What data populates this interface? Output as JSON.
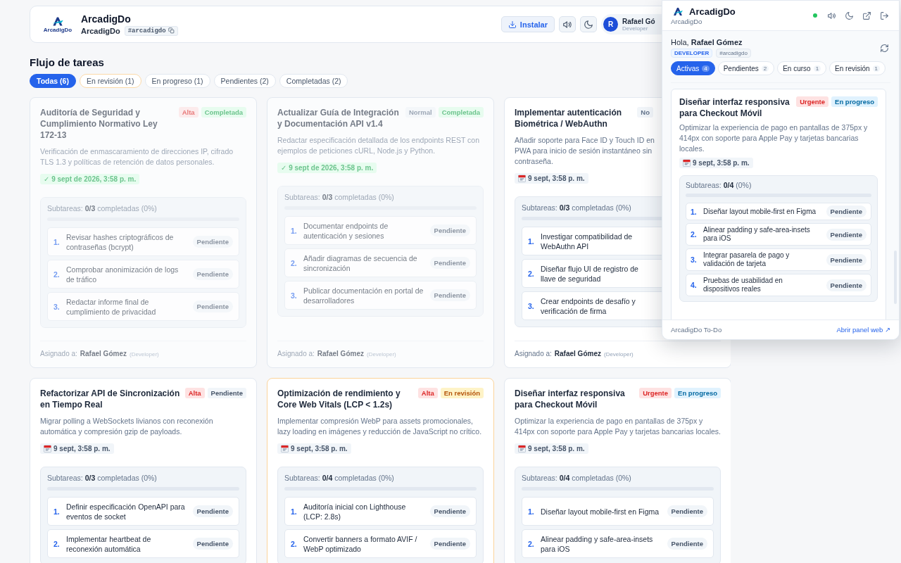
{
  "header": {
    "logo_text": "ArcadigDo",
    "title": "ArcadigDo",
    "subtitle": "ArcadigDo",
    "tag": "#arcadigdo",
    "install_button": "Instalar",
    "user": {
      "initial": "R",
      "name": "Rafael Gó",
      "role": "Developer"
    }
  },
  "section_title": "Flujo de tareas",
  "filters": [
    {
      "label": "Todas (6)",
      "selected": true,
      "kind": "all"
    },
    {
      "label": "En revisión (1)",
      "selected": false,
      "kind": "review"
    },
    {
      "label": "En progreso (1)",
      "selected": false,
      "kind": "progress"
    },
    {
      "label": "Pendientes (2)",
      "selected": false,
      "kind": "pending"
    },
    {
      "label": "Completadas (2)",
      "selected": false,
      "kind": "done"
    }
  ],
  "cards": [
    {
      "title": "Auditoría de Seguridad y Cumplimiento Normativo Ley 172-13",
      "priority": {
        "label": "Alta",
        "kind": "high"
      },
      "status": {
        "label": "Completada",
        "kind": "done"
      },
      "description": "Verificación de enmascaramiento de direcciones IP, cifrado TLS 1.3 y políticas de retención de datos personales.",
      "due": {
        "text": "✓ 9 sept de 2026, 3:58 p. m.",
        "kind": "done"
      },
      "subtasks_summary": "Subtareas: **0/3** completadas (0%)",
      "progress": {
        "level": 0
      },
      "subtasks": [
        {
          "number": "1.",
          "text": "Revisar hashes criptográficos de contraseñas (bcrypt)",
          "status": "Pendiente"
        },
        {
          "number": "2.",
          "text": "Comprobar anonimización de logs de tráfico",
          "status": "Pendiente"
        },
        {
          "number": "3.",
          "text": "Redactar informe final de cumplimiento de privacidad",
          "status": "Pendiente"
        }
      ],
      "assignee": {
        "label": "Asignado a:",
        "name": "Rafael Gómez",
        "role": "(Developer)"
      }
    },
    {
      "title": "Actualizar Guía de Integración y Documentación API v1.4",
      "priority": {
        "label": "Normal",
        "kind": "normal"
      },
      "status": {
        "label": "Completada",
        "kind": "done"
      },
      "description": "Redactar especificación detallada de los endpoints REST con ejemplos de peticiones cURL, Node.js y Python.",
      "due": {
        "text": "✓ 9 sept de 2026, 3:58 p. m.",
        "kind": "done"
      },
      "subtasks_summary": "Subtareas: **0/3** completadas (0%)",
      "progress": {
        "level": 0
      },
      "subtasks": [
        {
          "number": "1.",
          "text": "Documentar endpoints de autenticación y sesiones",
          "status": "Pendiente"
        },
        {
          "number": "2.",
          "text": "Añadir diagramas de secuencia de sincronización",
          "status": "Pendiente"
        },
        {
          "number": "3.",
          "text": "Publicar documentación en portal de desarrolladores",
          "status": "Pendiente"
        }
      ],
      "assignee": {
        "label": "Asignado a:",
        "name": "Rafael Gómez",
        "role": "(Developer)"
      }
    },
    {
      "title": "Implementar autenticación Biométrica / WebAuthn",
      "priority": {
        "label": "No",
        "kind": "normal"
      },
      "description": "Añadir soporte para Face ID y Touch ID en PWA para inicio de sesión instantáneo sin contraseña.",
      "due": {
        "text": "9 sept, 3:58 p. m.",
        "kind": "scheduled"
      },
      "subtasks_summary": "Subtareas: **0/3** completadas (0%)",
      "progress": {
        "level": 0
      },
      "subtasks": [
        {
          "number": "1.",
          "text": "Investigar compatibilidad de WebAuthn API"
        },
        {
          "number": "2.",
          "text": "Diseñar flujo UI de registro de llave de seguridad"
        },
        {
          "number": "3.",
          "text": "Crear endpoints de desafío y verificación de firma"
        }
      ],
      "assignee": {
        "label": "Asignado a:",
        "name": "Rafael Gómez",
        "role": "(Developer)"
      }
    },
    {
      "title": "Refactorizar API de Sincronización en Tiempo Real",
      "priority": {
        "label": "Alta",
        "kind": "high"
      },
      "status": {
        "label": "Pendiente",
        "kind": "pending"
      },
      "description": "Migrar polling a WebSockets livianos con reconexión automática y compresión gzip de payloads.",
      "due": {
        "text": "9 sept, 3:58 p. m.",
        "kind": "scheduled"
      },
      "subtasks_summary": "Subtareas: **0/3** completadas (0%)",
      "progress": {
        "level": 0
      },
      "subtasks": [
        {
          "number": "1.",
          "text": "Definir especificación OpenAPI para eventos de socket",
          "status": "Pendiente"
        },
        {
          "number": "2.",
          "text": "Implementar heartbeat de reconexión automática",
          "status": "Pendiente"
        }
      ]
    },
    {
      "title": "Optimización de rendimiento y Core Web Vitals (LCP < 1.2s)",
      "priority": {
        "label": "Alta",
        "kind": "high"
      },
      "status": {
        "label": "En revisión",
        "kind": "review"
      },
      "description": "Implementar compresión WebP para assets promocionales, lazy loading en imágenes y reducción de JavaScript no crítico.",
      "due": {
        "text": "9 sept, 3:58 p. m.",
        "kind": "scheduled"
      },
      "subtasks_summary": "Subtareas: **0/4** completadas (0%)",
      "progress": {
        "level": 0
      },
      "subtasks": [
        {
          "number": "1.",
          "text": "Auditoría inicial con Lighthouse (LCP: 2.8s)",
          "status": "Pendiente"
        },
        {
          "number": "2.",
          "text": "Convertir banners a formato AVIF / WebP optimizado",
          "status": "Pendiente"
        }
      ]
    },
    {
      "title": "Diseñar interfaz responsiva para Checkout Móvil",
      "priority": {
        "label": "Urgente",
        "kind": "urgent"
      },
      "status": {
        "label": "En progreso",
        "kind": "progress"
      },
      "description": "Optimizar la experiencia de pago en pantallas de 375px y 414px con soporte para Apple Pay y tarjetas bancarias locales.",
      "due": {
        "text": "9 sept, 3:58 p. m.",
        "kind": "scheduled"
      },
      "subtasks_summary": "Subtareas: **0/4** completadas (0%)",
      "progress": {
        "level": 0
      },
      "subtasks": [
        {
          "number": "1.",
          "text": "Diseñar layout mobile-first en Figma",
          "status": "Pendiente"
        },
        {
          "number": "2.",
          "text": "Alinear padding y safe-area-insets para iOS",
          "status": "Pendiente"
        }
      ]
    }
  ],
  "popup": {
    "title": "ArcadigDo",
    "subtitle": "ArcadigDo",
    "online_dot": {
      "color": "#22c55e"
    },
    "greeting": "Hola, **Rafael Gómez**",
    "role_badge": "DEVELOPER",
    "tag": "#arcadigdo",
    "tabs": [
      {
        "label": "Activas",
        "count": "4",
        "selected": true
      },
      {
        "label": "Pendientes",
        "count": "2",
        "selected": false
      },
      {
        "label": "En curso",
        "count": "1",
        "selected": false
      },
      {
        "label": "En revisión",
        "count": "1",
        "selected": false
      }
    ],
    "card": {
      "title": "Diseñar interfaz responsiva para Checkout Móvil",
      "priority": {
        "label": "Urgente",
        "kind": "urgent"
      },
      "status": {
        "label": "En progreso",
        "kind": "progress"
      },
      "description": "Optimizar la experiencia de pago en pantallas de 375px y 414px con soporte para Apple Pay y tarjetas bancarias locales.",
      "due": {
        "text": "9 sept, 3:58 p. m.",
        "kind": "scheduled"
      },
      "subtasks_summary": "Subtareas: **0/4** (0%)",
      "progress": {
        "level": 0
      },
      "subtasks": [
        {
          "number": "1.",
          "text": "Diseñar layout mobile-first en Figma",
          "status": "Pendiente"
        },
        {
          "number": "2.",
          "text": "Alinear padding y safe-area-insets para iOS",
          "status": "Pendiente"
        },
        {
          "number": "3.",
          "text": "Integrar pasarela de pago y validación de tarjeta",
          "status": "Pendiente"
        },
        {
          "number": "4.",
          "text": "Pruebas de usabilidad en dispositivos reales",
          "status": "Pendiente"
        }
      ]
    },
    "footer_text": "ArcadigDo To-Do",
    "footer_link": "Abrir panel web ↗"
  }
}
